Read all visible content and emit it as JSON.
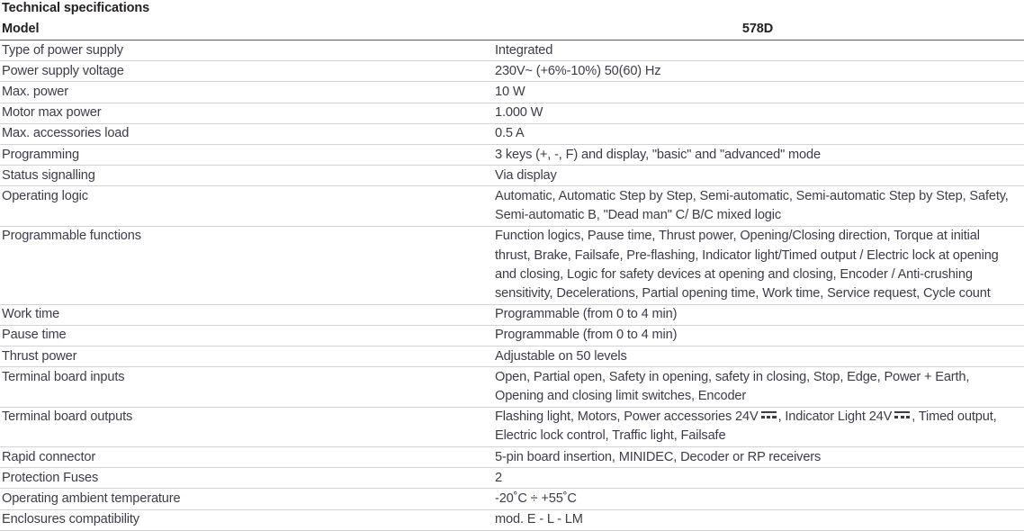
{
  "document": {
    "section_title": "Technical specifications"
  },
  "table": {
    "headers": {
      "label": "Model",
      "model": "578D"
    },
    "rows": [
      {
        "label": "Type of power supply",
        "value": "Integrated"
      },
      {
        "label": "Power supply voltage",
        "value": "230V~ (+6%-10%) 50(60) Hz"
      },
      {
        "label": "Max. power",
        "value": "10 W"
      },
      {
        "label": "Motor max power",
        "value": "1.000 W"
      },
      {
        "label": "Max. accessories load",
        "value": "0.5 A"
      },
      {
        "label": "Programming",
        "value": "3 keys (+, -, F) and display, \"basic\" and \"advanced\" mode"
      },
      {
        "label": "Status signalling",
        "value": "Via display"
      },
      {
        "label": "Operating logic",
        "value": "Automatic, Automatic Step by Step, Semi-automatic, Semi-automatic Step by Step, Safety, Semi-automatic B, \"Dead man\" C/ B/C mixed logic"
      },
      {
        "label": "Programmable functions",
        "value": "Function logics, Pause time, Thrust power, Opening/Closing direction, Torque at initial thrust, Brake, Failsafe, Pre-flashing, Indicator light/Timed output / Electric lock at opening and closing, Logic for safety devices at opening and closing, Encoder / Anti-crushing sensitivity, Decelerations, Partial opening time, Work time, Service request, Cycle count"
      },
      {
        "label": "Work time",
        "value": "Programmable (from 0 to 4 min)"
      },
      {
        "label": "Pause time",
        "value": "Programmable (from 0 to 4 min)"
      },
      {
        "label": "Thrust power",
        "value": "Adjustable on 50 levels"
      },
      {
        "label": "Terminal board inputs",
        "value": "Open, Partial open, Safety in opening, safety in closing, Stop, Edge, Power + Earth, Opening and closing limit switches, Encoder"
      },
      {
        "label": "Terminal board outputs",
        "value_parts": {
          "part1": "Flashing light, Motors, Power accessories 24V",
          "part2": ", Indicator Light 24V",
          "part3": ", Timed output, Electric lock control, Traffic light, Failsafe"
        }
      },
      {
        "label": "Rapid connector",
        "value": "5-pin board insertion, MINIDEC, Decoder or RP receivers"
      },
      {
        "label": "Protection Fuses",
        "value": "2"
      },
      {
        "label": "Operating ambient temperature",
        "value": "-20˚C ÷ +55˚C"
      },
      {
        "label": "Enclosures compatibility",
        "value": "mod. E - L - LM"
      }
    ]
  },
  "colors": {
    "text": "#3f3a4a",
    "heading": "#231f20",
    "rule_light": "#d3d3d4",
    "rule_dark": "#58595b"
  }
}
